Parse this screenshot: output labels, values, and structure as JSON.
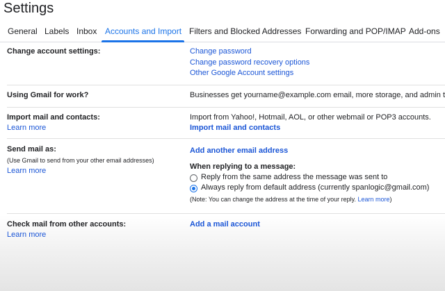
{
  "page": {
    "title": "Settings"
  },
  "tabs": [
    {
      "label": "General"
    },
    {
      "label": "Labels"
    },
    {
      "label": "Inbox"
    },
    {
      "label": "Accounts and Import"
    },
    {
      "label": "Filters and Blocked Addresses"
    },
    {
      "label": "Forwarding and POP/IMAP"
    },
    {
      "label": "Add-ons"
    }
  ],
  "sections": {
    "change_account": {
      "label": "Change account settings:",
      "links": [
        "Change password",
        "Change password recovery options",
        "Other Google Account settings"
      ]
    },
    "work": {
      "label": "Using Gmail for work?",
      "text": "Businesses get yourname@example.com email, more storage, and admin t"
    },
    "import": {
      "label": "Import mail and contacts:",
      "learn_more": "Learn more",
      "text": "Import from Yahoo!, Hotmail, AOL, or other webmail or POP3 accounts.",
      "action": "Import mail and contacts"
    },
    "send_as": {
      "label": "Send mail as:",
      "sub": "(Use Gmail to send from your other email addresses)",
      "learn_more": "Learn more",
      "action": "Add another email address",
      "reply_heading": "When replying to a message:",
      "options": [
        {
          "label": "Reply from the same address the message was sent to",
          "selected": false
        },
        {
          "label": "Always reply from default address (currently spanlogic@gmail.com)",
          "selected": true
        }
      ],
      "note": "(Note: You can change the address at the time of your reply.",
      "note_link": "Learn more",
      "note_end": ")"
    },
    "check_mail": {
      "label": "Check mail from other accounts:",
      "learn_more": "Learn more",
      "action": "Add a mail account"
    }
  },
  "colors": {
    "accent": "#1a73e8",
    "link": "#1a55d6"
  }
}
